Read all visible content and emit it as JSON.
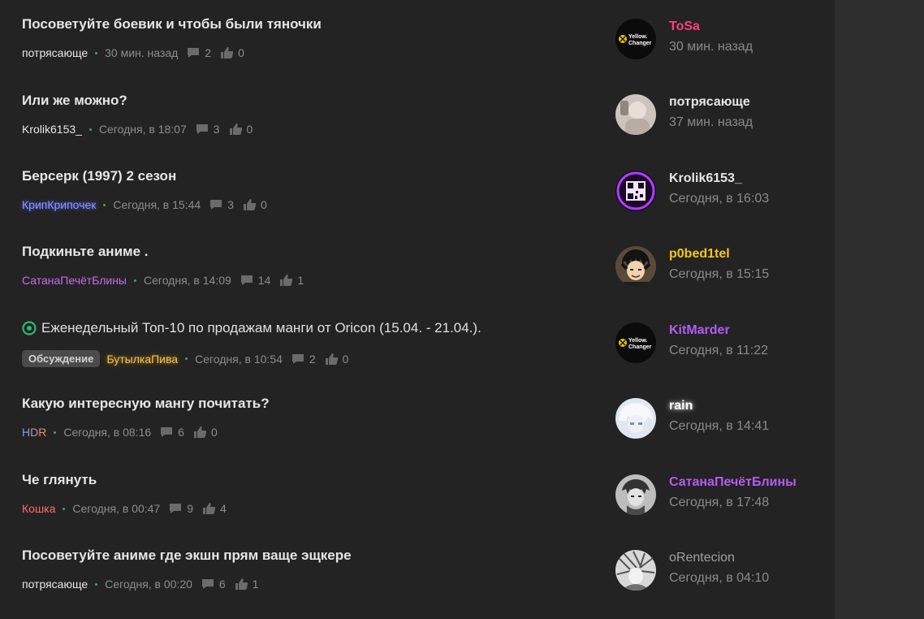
{
  "threads": [
    {
      "title": "Посоветуйте боевик и чтобы были тяночки",
      "author": "потрясающе",
      "author_color": "#e6e6e6",
      "time": "30 мин. назад",
      "replies": "2",
      "likes": "0"
    },
    {
      "title": "Или же можно?",
      "author": "Krolik6153_",
      "author_color": "#e6e6e6",
      "time": "Сегодня, в 18:07",
      "replies": "3",
      "likes": "0"
    },
    {
      "title": "Берсерк (1997) 2 сезон",
      "author": "КрипКрипочек",
      "author_color": "#8f9cff",
      "time": "Сегодня, в 15:44",
      "replies": "3",
      "likes": "0"
    },
    {
      "title": "Подкиньте аниме .",
      "author": "СатанаПечётБлины",
      "author_color": "#c86af0",
      "time": "Сегодня, в 14:09",
      "replies": "14",
      "likes": "1"
    },
    {
      "title": "Еженедельный Топ-10 по продажам манги от Oricon (15.04. - 21.04.).",
      "badge": "Обсуждение",
      "author": "БутылкаПива",
      "author_color": "#f0c35a",
      "time": "Сегодня, в 10:54",
      "replies": "2",
      "likes": "0"
    },
    {
      "title": "Какую интересную мангу почитать?",
      "author": "HDR",
      "author_color": "#5fa8ff",
      "time": "Сегодня, в 08:16",
      "replies": "6",
      "likes": "0"
    },
    {
      "title": "Че глянуть",
      "author": "Кошка",
      "author_color": "#ff6b6b",
      "time": "Сегодня, в 00:47",
      "replies": "9",
      "likes": "4"
    },
    {
      "title": "Посоветуйте аниме где экшн прям ваще эщкере",
      "author": "потрясающе",
      "author_color": "#e6e6e6",
      "time": "Сегодня, в 00:20",
      "replies": "6",
      "likes": "1"
    }
  ],
  "last_posts": [
    {
      "name": "ToSa",
      "name_color": "#ff3d7f",
      "time": "30 мин. назад",
      "avatar": "yellow-changer-logo",
      "avatar_text": "Yellow. Changer"
    },
    {
      "name": "потрясающе",
      "name_color": "#e6e6e6",
      "time": "37 мин. назад",
      "avatar": "person-photo"
    },
    {
      "name": "Krolik6153_",
      "name_color": "#e6e6e6",
      "time": "Сегодня, в 16:03",
      "avatar": "qr-code"
    },
    {
      "name": "p0bed1tel",
      "name_color": "#f5c518",
      "time": "Сегодня, в 15:15",
      "avatar": "anime-character"
    },
    {
      "name": "KitMarder",
      "name_color": "#b45cf0",
      "time": "Сегодня, в 11:22",
      "avatar": "yellow-changer-logo",
      "avatar_text": "Yellow. Changer"
    },
    {
      "name": "rain",
      "name_color": "#ffffff",
      "time": "Сегодня, в 14:41",
      "avatar": "anime-character-light"
    },
    {
      "name": "СатанаПечётБлины",
      "name_color": "#b45cf0",
      "time": "Сегодня, в 17:48",
      "avatar": "grayscale-character"
    },
    {
      "name": "oRentecion",
      "name_color": "#a0a0a0",
      "time": "Сегодня, в 04:10",
      "avatar": "manga-character"
    }
  ],
  "colors": {
    "background": "#232323",
    "text": "#e6e6e6",
    "muted": "#8d8d8d",
    "dot": "#3aa66a",
    "pin": "#2bb673"
  }
}
